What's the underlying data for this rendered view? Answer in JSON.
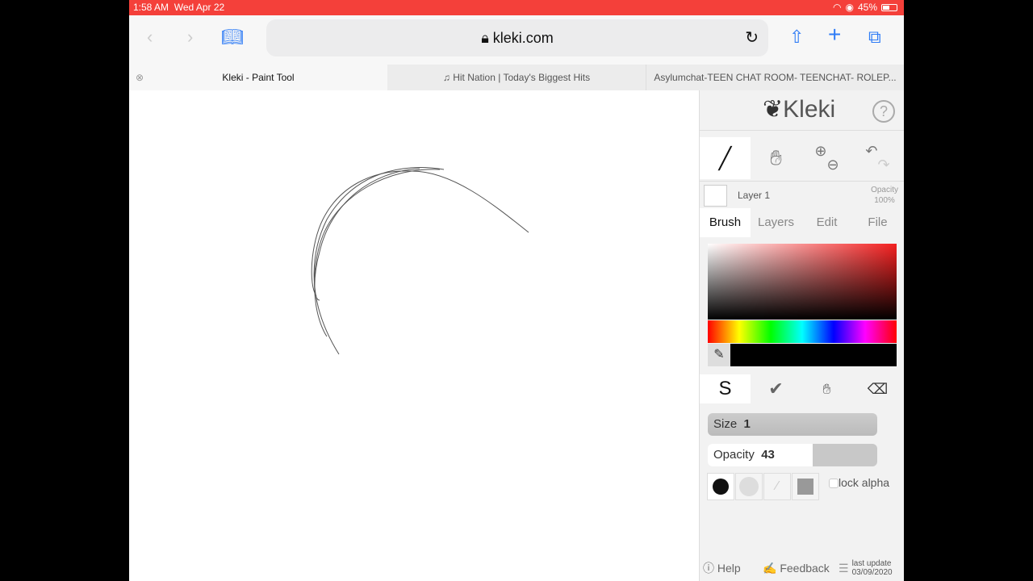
{
  "status_bar": {
    "time": "1:58 AM",
    "date": "Wed Apr 22",
    "battery": "45%"
  },
  "browser": {
    "url": "kleki.com",
    "tabs": [
      {
        "label": "Kleki - Paint Tool",
        "active": true
      },
      {
        "label": "♫ Hit Nation | Today's Biggest Hits"
      },
      {
        "label": "Asylumchat-TEEN CHAT ROOM- TEENCHAT- ROLEP..."
      }
    ]
  },
  "app": {
    "logo": "Kleki",
    "layer": {
      "name": "Layer 1",
      "opacity_label": "Opacity",
      "opacity_value": "100%"
    },
    "panel_tabs": [
      "Brush",
      "Layers",
      "Edit",
      "File"
    ],
    "active_tab": "Brush",
    "current_color": "#000000",
    "size": {
      "label": "Size",
      "value": "1"
    },
    "opacity": {
      "label": "Opacity",
      "value": "43"
    },
    "lock_alpha": "lock alpha",
    "footer": {
      "help": "Help",
      "feedback": "Feedback",
      "last_update_label": "last update",
      "last_update_date": "03/09/2020"
    }
  },
  "colors": {
    "status_bar": "#f4403a",
    "accent": "#2f7cf6"
  }
}
